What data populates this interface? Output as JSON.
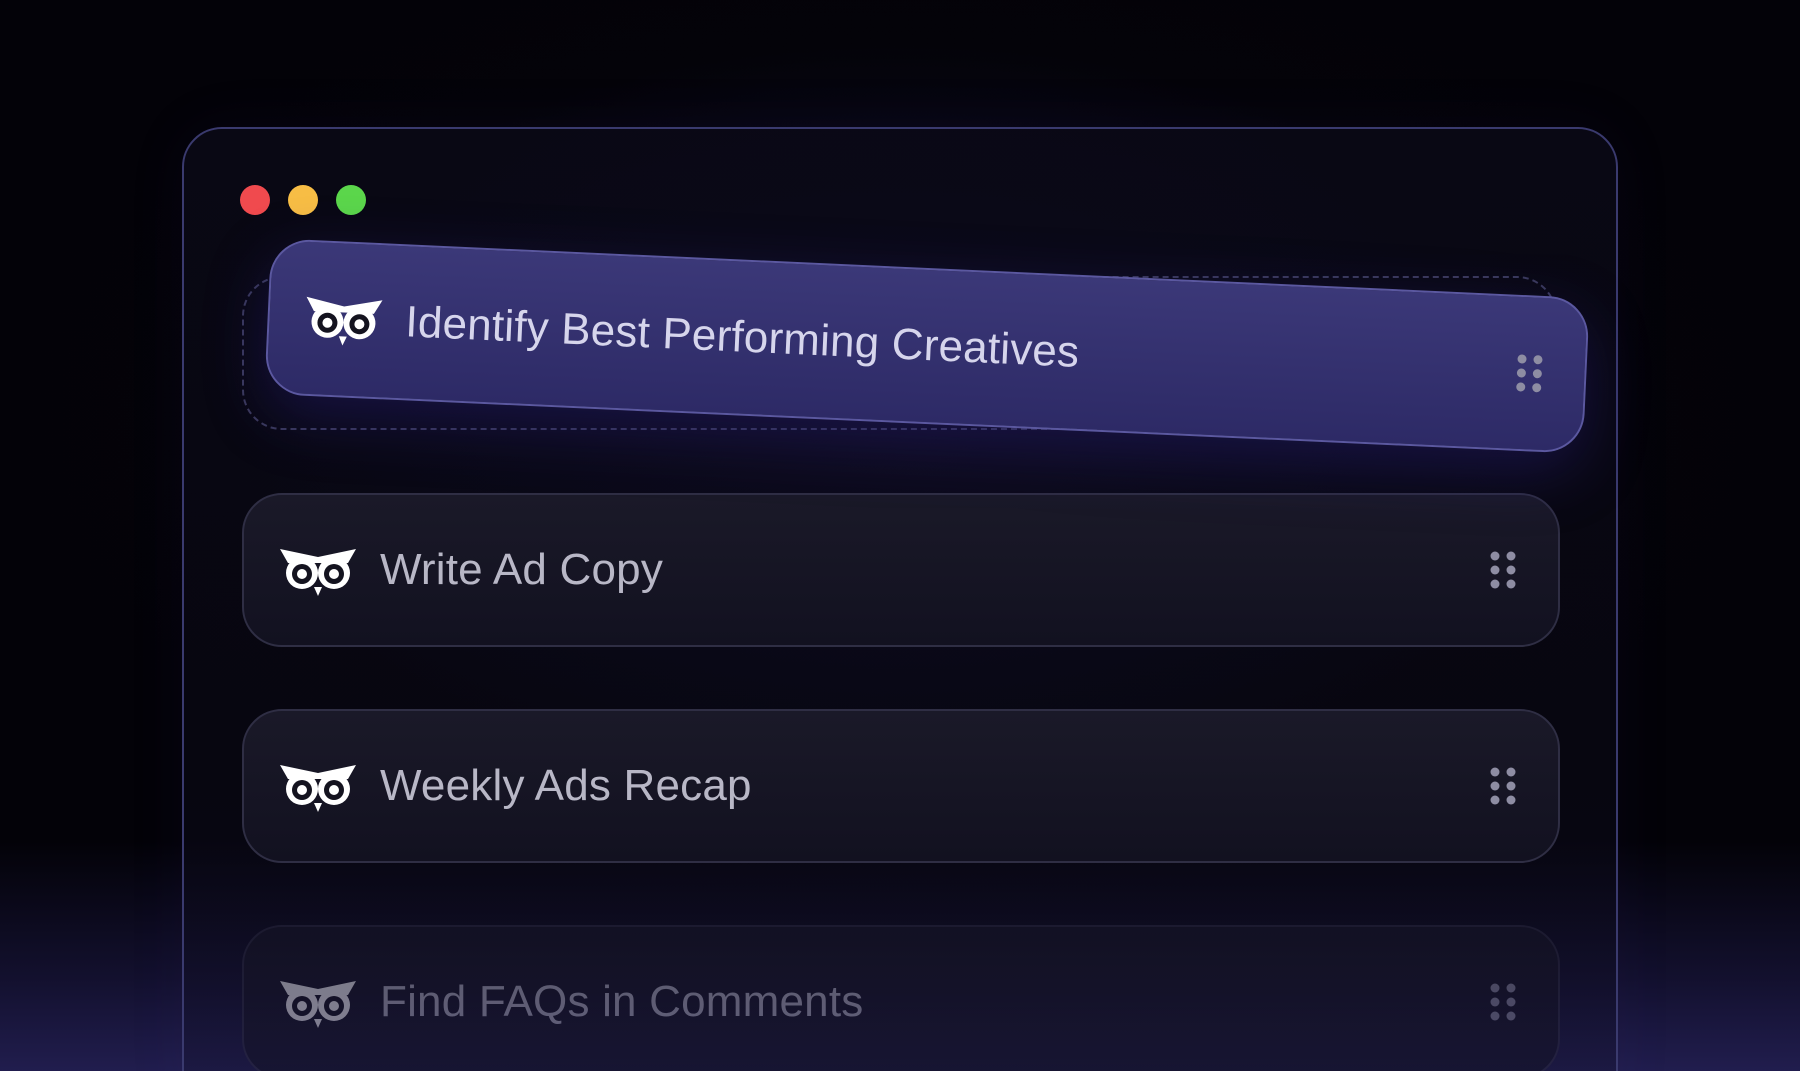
{
  "window": {
    "controls": [
      "close",
      "minimize",
      "maximize"
    ]
  },
  "colors": {
    "close": "#f04a4e",
    "minimize": "#f7bd45",
    "maximize": "#5bd64b",
    "dragging_card": "#2d2a66",
    "card": "#141322"
  },
  "tasks": [
    {
      "label": "Identify Best Performing Creatives",
      "icon": "owl-icon",
      "state": "dragging"
    },
    {
      "label": "Write Ad Copy",
      "icon": "owl-icon",
      "state": "normal"
    },
    {
      "label": "Weekly Ads Recap",
      "icon": "owl-icon",
      "state": "normal"
    },
    {
      "label": "Find FAQs in Comments",
      "icon": "owl-icon",
      "state": "faded"
    }
  ],
  "drag_handle_icon": "grip-dots-icon"
}
